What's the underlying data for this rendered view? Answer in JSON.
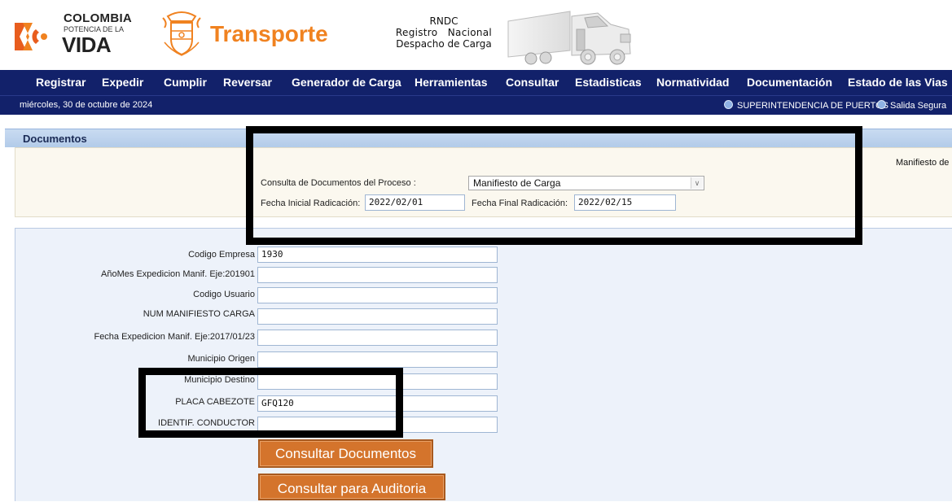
{
  "header": {
    "logo_line1": "COLOMBIA",
    "logo_line2": "POTENCIA DE LA",
    "logo_line3": "VIDA",
    "transporte": "Transporte",
    "rndc_line1": "RNDC",
    "rndc_line2": "Registro   Nacional",
    "rndc_line3": "Despacho de Carga"
  },
  "nav": {
    "items": [
      "Registrar",
      "Expedir",
      "Cumplir",
      "Reversar",
      "Generador de Carga",
      "Herramientas",
      "Consultar",
      "Estadisticas",
      "Normatividad",
      "Documentación",
      "Estado de las Vias"
    ]
  },
  "subbar": {
    "date": "miércoles, 30 de octubre de 2024",
    "link_super": "SUPERINTENDENCIA DE PUERTOS",
    "link_salida": "Salida Segura"
  },
  "documentos": {
    "title": "Documentos",
    "right_label": "Manifiesto de Carga",
    "consulta_label": "Consulta de Documentos del Proceso :",
    "consulta_value": "Manifiesto de Carga",
    "fecha_inicial_label": "Fecha Inicial Radicación:",
    "fecha_inicial_value": "2022/02/01",
    "fecha_final_label": "Fecha Final Radicación:",
    "fecha_final_value": "2022/02/15"
  },
  "form": {
    "fields": [
      {
        "label": "Codigo Empresa",
        "value": "1930"
      },
      {
        "label": "AñoMes Expedicion Manif. Eje:201901",
        "value": ""
      },
      {
        "label": "Codigo Usuario",
        "value": ""
      },
      {
        "label": "NUM MANIFIESTO CARGA",
        "value": ""
      },
      {
        "label": "Fecha Expedicion Manif. Eje:2017/01/23",
        "value": ""
      },
      {
        "label": "Municipio Origen",
        "value": ""
      },
      {
        "label": "Municipio Destino",
        "value": ""
      },
      {
        "label": "PLACA CABEZOTE",
        "value": "GFQ120"
      },
      {
        "label": "IDENTIF. CONDUCTOR",
        "value": ""
      }
    ],
    "btn_consultar": "Consultar Documentos",
    "btn_auditoria": "Consultar para Auditoria"
  },
  "colors": {
    "nav_bg": "#12216a",
    "brand_orange": "#f08220",
    "button_orange": "#d4742c"
  }
}
